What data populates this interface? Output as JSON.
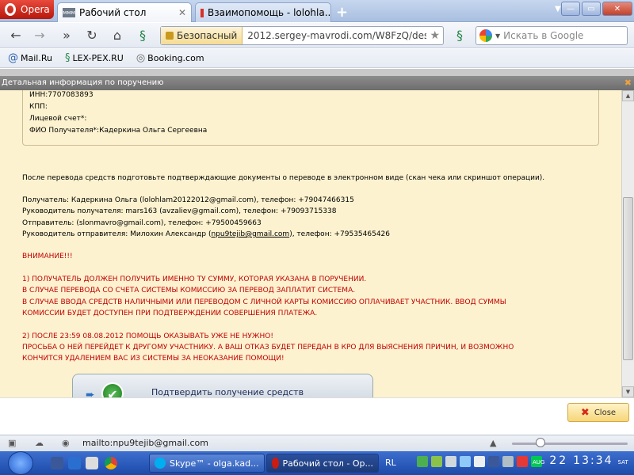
{
  "browser": {
    "menu_label": "Opera",
    "tabs": [
      {
        "title": "Рабочий стол",
        "favicon": "ммм"
      },
      {
        "title": "Взаимопомощь - lolohla..."
      }
    ],
    "address": {
      "security_label": "Безопасный",
      "url": "2012.sergey-mavrodi.com/W8FzQ/desktop.html"
    },
    "search": {
      "placeholder": "Искать в Google"
    },
    "bookmarks": [
      "Mail.Ru",
      "LEX-PEX.RU",
      "Booking.com"
    ]
  },
  "dialog": {
    "title": "Детальная информация по поручению",
    "fields": [
      "ИНН:7707083893",
      "КПП:",
      "Лицевой счет*:",
      "ФИО Получателя*:Кадеркина Ольга Сергеевна"
    ],
    "instruction": "После перевода средств подготовьте подтверждающие документы о переводе в электронном виде (скан чека или скриншот операции).",
    "contacts": [
      "Получатель: Кадеркина Ольга (lolohlam20122012@gmail.com), телефон: +79047466315",
      "Руководитель получателя: mars163 (avzaliev@gmail.com), телефон: +79093715338",
      "Отправитель: (slonmavro@gmail.com), телефон: +79500459663"
    ],
    "sender_leader": {
      "prefix": "Руководитель отправителя: Милохин Александр (",
      "email": "npu9tejib@gmail.com",
      "suffix": "), телефон: +79535465426"
    },
    "warning_title": "ВНИМАНИЕ!!!",
    "warning_1": [
      "1) ПОЛУЧАТЕЛЬ ДОЛЖЕН ПОЛУЧИТЬ ИМЕННО ТУ СУММУ, КОТОРАЯ УКАЗАНА В ПОРУЧЕНИИ.",
      "В СЛУЧАЕ ПЕРЕВОДА СО СЧЕТА СИСТЕМЫ КОМИССИЮ ЗА ПЕРЕВОД ЗАПЛАТИТ СИСТЕМА.",
      "В СЛУЧАЕ ВВОДА СРЕДСТВ НАЛИЧНЫМИ ИЛИ ПЕРЕВОДОМ С ЛИЧНОЙ КАРТЫ КОМИССИЮ ОПЛАЧИВАЕТ УЧАСТНИК. ВВОД СУММЫ",
      "КОМИССИИ БУДЕТ ДОСТУПЕН ПРИ ПОДТВЕРЖДЕНИИ СОВЕРШЕНИЯ ПЛАТЕЖА."
    ],
    "warning_2": [
      "2) ПОСЛЕ 23:59 08.08.2012 ПОМОЩЬ ОКАЗЫВАТЬ УЖЕ НЕ НУЖНО!",
      "ПРОСЬБА О НЕЙ ПЕРЕЙДЕТ К ДРУГОМУ УЧАСТНИКУ. А ВАШ ОТКАЗ БУДЕТ ПЕРЕДАН В КРО ДЛЯ ВЫЯСНЕНИЯ ПРИЧИН, И ВОЗМОЖНО",
      "КОНЧИТСЯ УДАЛЕНИЕМ ВАС ИЗ СИСТЕМЫ ЗА НЕОКАЗАНИЕ ПОМОЩИ!"
    ],
    "confirm_label": "Подтвердить получение средств",
    "close_label": "Close"
  },
  "status": {
    "link": "mailto:npu9tejib@gmail.com"
  },
  "taskbar": {
    "tasks": [
      "Skype™ - olga.kad...",
      "Рабочий стол - Op..."
    ],
    "lang": "RL",
    "date_day": "22",
    "date_month": "AUG",
    "time": "13:34",
    "weekday": "SAT"
  },
  "colors": {
    "warning": "#c00000",
    "dialog_bg": "#fdf2cf",
    "opera_red": "#cc1b10"
  }
}
